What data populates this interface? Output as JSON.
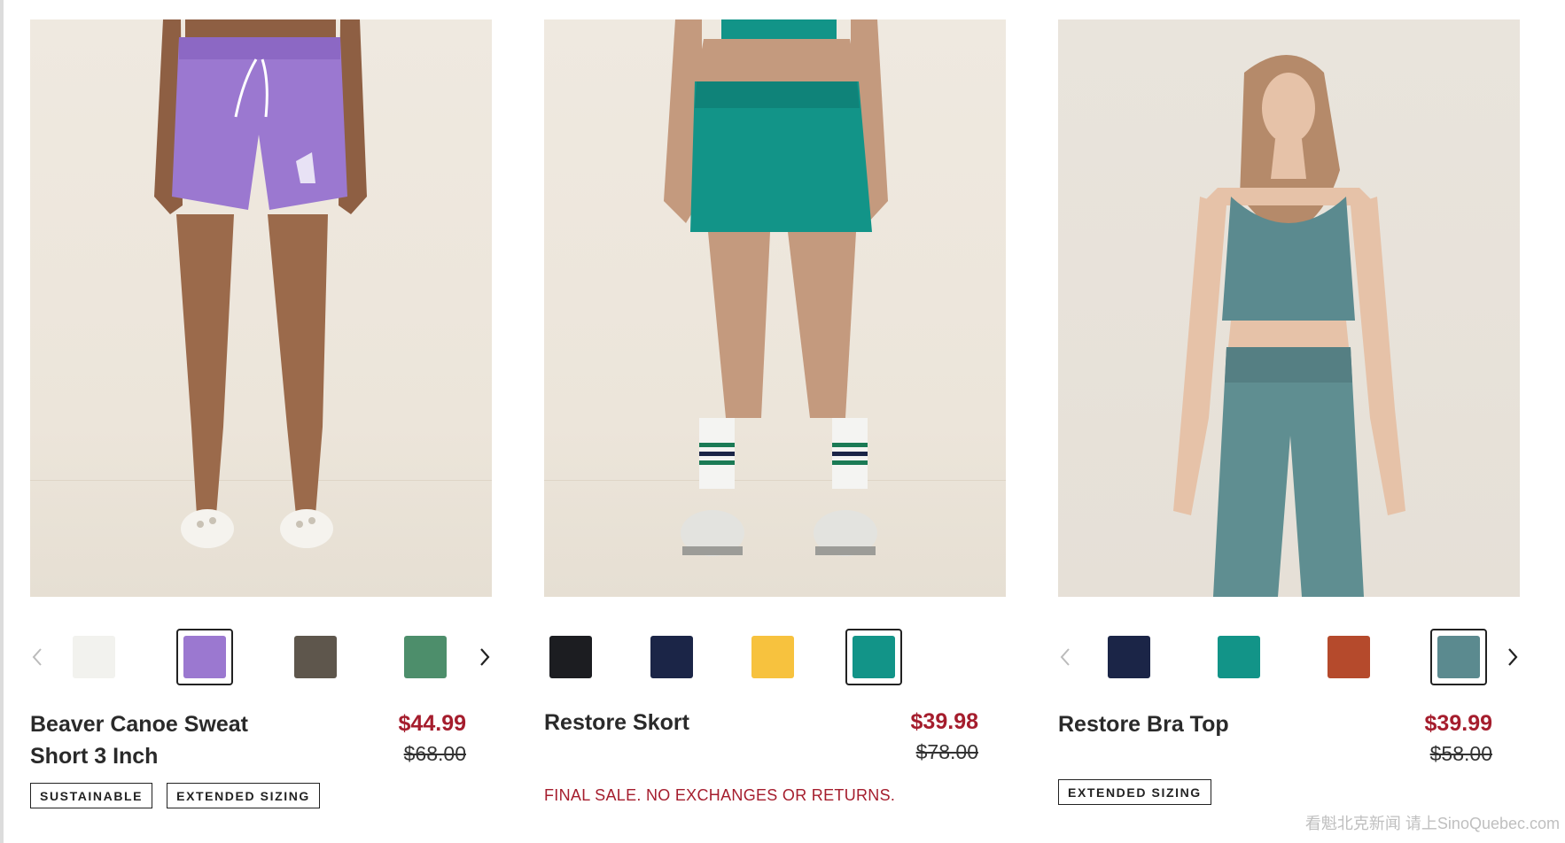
{
  "products": [
    {
      "name": "Beaver Canoe Sweat Short 3 Inch",
      "sale_price": "$44.99",
      "original_price": "$68.00",
      "badges": [
        "SUSTAINABLE",
        "EXTENDED SIZING"
      ],
      "swatches": [
        "#f2f2ee",
        "#9b78d0",
        "#5e564c",
        "#4d8e6b"
      ],
      "selected_swatch": 1
    },
    {
      "name": "Restore Skort",
      "sale_price": "$39.98",
      "original_price": "$78.00",
      "notice": "FINAL SALE. NO EXCHANGES OR RETURNS.",
      "swatches": [
        "#1c1d21",
        "#1b2547",
        "#f7c23e",
        "#129488"
      ],
      "selected_swatch": 3
    },
    {
      "name": "Restore Bra Top",
      "sale_price": "$39.99",
      "original_price": "$58.00",
      "badges": [
        "EXTENDED SIZING"
      ],
      "swatches": [
        "#1b2547",
        "#129488",
        "#b54a2c",
        "#5b8a8f"
      ],
      "selected_swatch": 3
    }
  ],
  "watermark": "看魁北克新闻 请上SinoQuebec.com",
  "colors": {
    "sale_red": "#a51d2d",
    "text_dark": "#2a2a2a",
    "photo_bg": "#ece5da"
  },
  "icons": {
    "prev": "chevron-left-icon",
    "next": "chevron-right-icon"
  }
}
